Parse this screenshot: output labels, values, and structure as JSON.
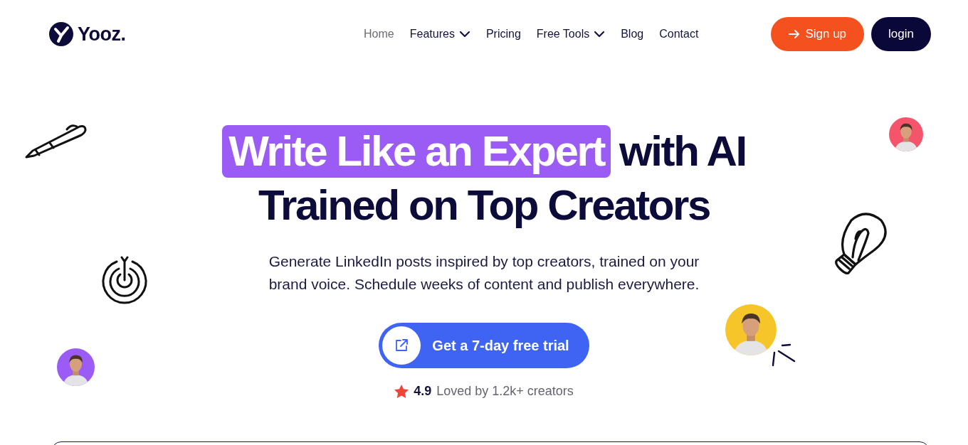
{
  "brand": {
    "name": "Yooz."
  },
  "nav": [
    {
      "label": "Home",
      "selected": true,
      "kind": "link"
    },
    {
      "label": "Features",
      "selected": false,
      "kind": "dropdown"
    },
    {
      "label": "Pricing",
      "selected": false,
      "kind": "link"
    },
    {
      "label": "Free Tools",
      "selected": false,
      "kind": "dropdown"
    },
    {
      "label": "Blog",
      "selected": false,
      "kind": "link"
    },
    {
      "label": "Contact",
      "selected": false,
      "kind": "link"
    }
  ],
  "actions": [
    {
      "label": "Sign up",
      "kind": "primary"
    },
    {
      "label": "login",
      "kind": "dark"
    }
  ],
  "hero": {
    "highlight": "Write Like an Expert",
    "title_rest": "with AI",
    "title_line2": "Trained on Top Creators",
    "subtitle": "Generate LinkedIn posts inspired by top creators, trained on your brand voice. Schedule weeks of content and publish everywhere.",
    "cta": "Get a 7-day free trial",
    "rating": "4.9",
    "rating_text": "Loved by 1.2k+ creators"
  }
}
